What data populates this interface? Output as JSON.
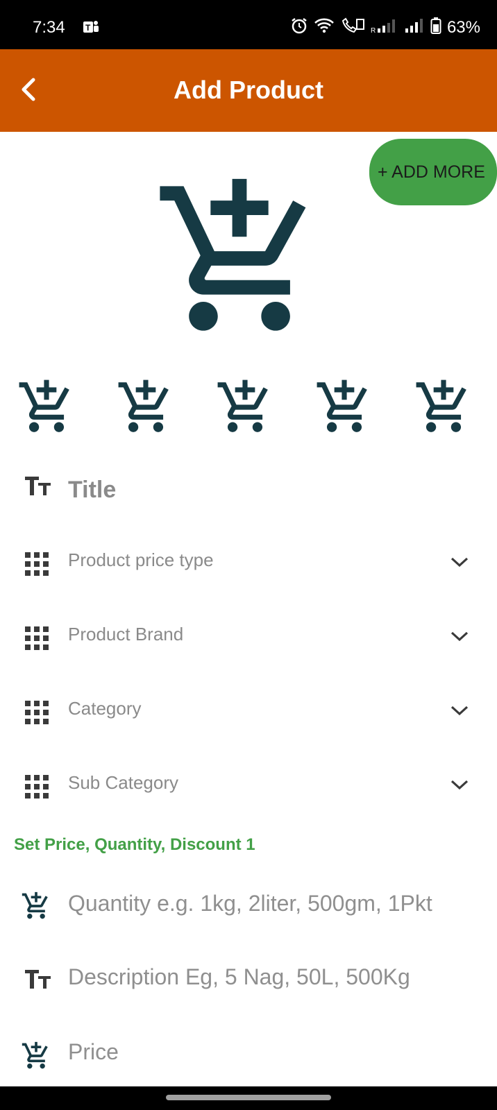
{
  "status_bar": {
    "time": "7:34",
    "battery": "63%",
    "icons": [
      "teams-icon",
      "alarm-icon",
      "wifi-icon",
      "call-icon",
      "signal-icon",
      "signal-icon",
      "battery-icon"
    ]
  },
  "app_bar": {
    "title": "Add Product",
    "back_icon": "back-arrow-icon",
    "color": "#cc5500"
  },
  "add_more": {
    "label": "+ ADD MORE",
    "color": "#43a047"
  },
  "product_image": {
    "icon": "add-cart-icon",
    "thumbnails": 5,
    "icon_color": "#163a44"
  },
  "form": {
    "title_placeholder": "Title",
    "dropdowns": [
      {
        "label": "Product price type"
      },
      {
        "label": "Product Brand"
      },
      {
        "label": "Category"
      },
      {
        "label": "Sub Category"
      }
    ],
    "section_title": "Set Price, Quantity, Discount 1",
    "quantity_placeholder": "Quantity e.g. 1kg, 2liter, 500gm, 1Pkt",
    "description_placeholder": "Description Eg, 5 Nag, 50L, 500Kg",
    "price_placeholder": "Price"
  }
}
